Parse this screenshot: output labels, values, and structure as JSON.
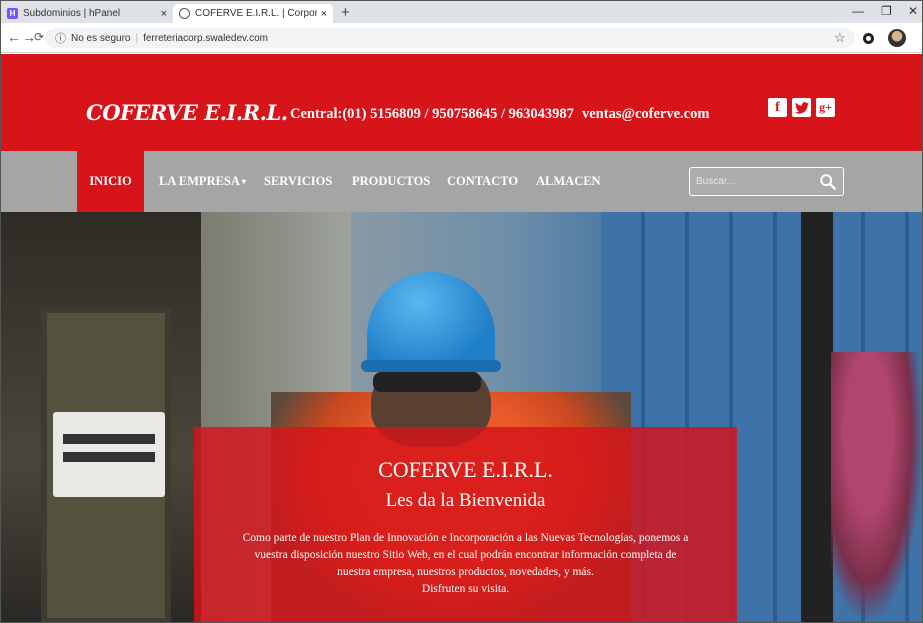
{
  "browser": {
    "tabs": [
      {
        "title": "Subdominios | hPanel"
      },
      {
        "title": "COFERVE E.I.R.L. | Corporacion Fe"
      }
    ],
    "close_glyph": "×",
    "new_tab_glyph": "+",
    "address": {
      "security_label": "No es seguro",
      "url": "ferreteriacorp.swaledev.com"
    }
  },
  "header": {
    "logo": "COFERVE E.I.R.L.",
    "central": "Central:(01) 5156809 / 950758645 / 963043987",
    "email": "ventas@coferve.com",
    "social": [
      {
        "icon": "facebook-icon",
        "glyph": "f"
      },
      {
        "icon": "twitter-icon",
        "glyph": "t"
      },
      {
        "icon": "google-plus-icon",
        "glyph": "g+"
      }
    ]
  },
  "menu": {
    "items": [
      {
        "label": "INICIO",
        "active": true
      },
      {
        "label": "LA EMPRESA",
        "dropdown": true
      },
      {
        "label": "SERVICIOS"
      },
      {
        "label": "PRODUCTOS"
      },
      {
        "label": "CONTACTO"
      },
      {
        "label": "ALMACEN"
      }
    ],
    "caret": "▾",
    "search_placeholder": "Buscar..."
  },
  "hero": {
    "title": "COFERVE E.I.R.L.",
    "subtitle": "Les da la Bienvenida",
    "body_lines": [
      "Como parte de nuestro Plan de Innovación e Incorporación a las Nuevas Tecnologías, ponemos a",
      "vuestra disposición nuestro Sitio Web, en el cual podrán encontrar información completa de",
      "nuestra empresa, nuestros productos, novedades, y más.",
      "Disfruten su visita."
    ]
  },
  "colors": {
    "brand_red": "#d7141a",
    "nav_gray": "#a5a5a5"
  }
}
